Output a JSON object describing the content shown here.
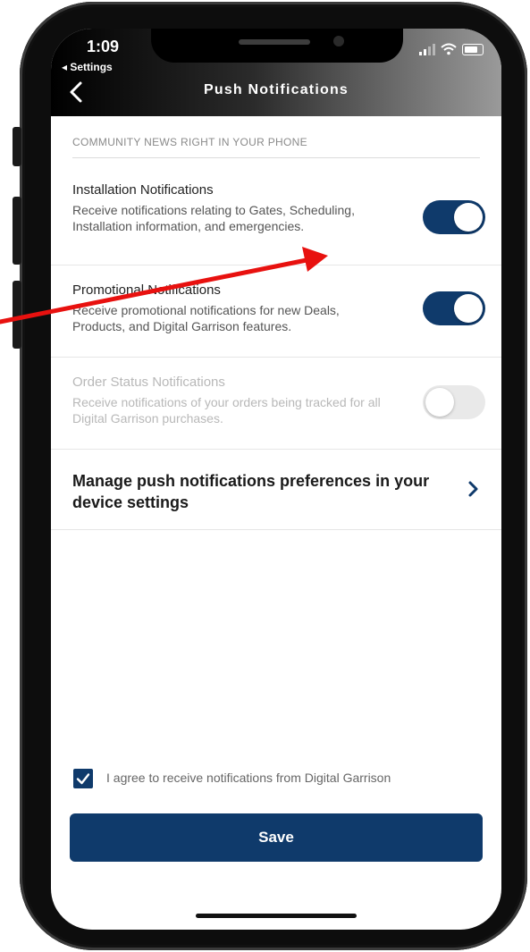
{
  "status_bar": {
    "time": "1:09",
    "back_app": "◂ Settings"
  },
  "header": {
    "title": "Push Notifications"
  },
  "section": {
    "label": "COMMUNITY NEWS RIGHT IN YOUR PHONE"
  },
  "notifications": [
    {
      "title": "Installation Notifications",
      "description": "Receive notifications relating to Gates, Scheduling, Installation information, and emergencies.",
      "enabled": true,
      "disabled": false
    },
    {
      "title": "Promotional Notifications",
      "description": "Receive promotional notifications for new Deals, Products, and Digital Garrison features.",
      "enabled": true,
      "disabled": false
    },
    {
      "title": "Order Status Notifications",
      "description": "Receive notifications of your orders being tracked for all Digital Garrison purchases.",
      "enabled": false,
      "disabled": true
    }
  ],
  "manage": {
    "label": "Manage push notifications preferences in your device settings"
  },
  "agree": {
    "label": "I agree to receive notifications from Digital Garrison",
    "checked": true
  },
  "save": {
    "label": "Save"
  },
  "colors": {
    "accent": "#0f3a6b",
    "annotation_arrow": "#e8110f"
  }
}
